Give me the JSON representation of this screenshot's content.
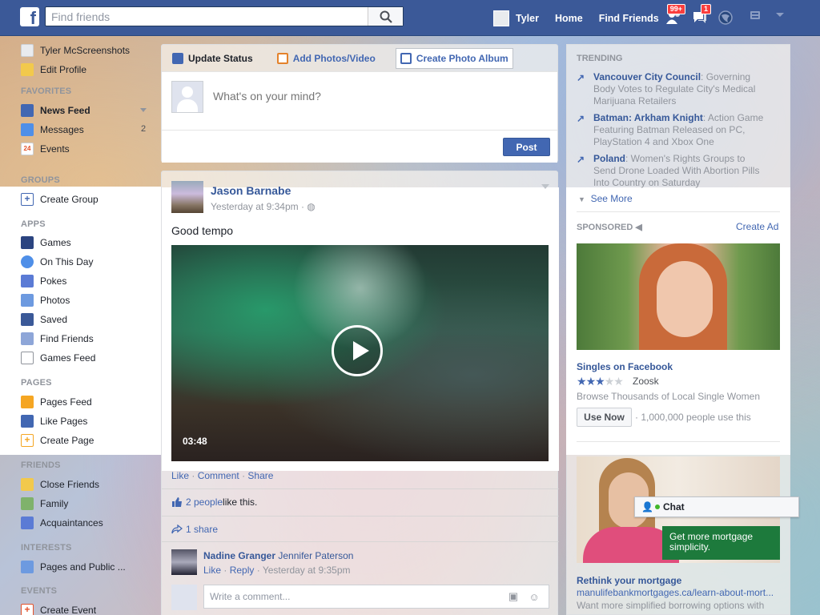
{
  "topbar": {
    "logo": "f",
    "search_placeholder": "Find friends",
    "user_name": "Tyler",
    "home": "Home",
    "find_friends": "Find Friends",
    "friend_requests_badge": "99+",
    "messages_badge": "1"
  },
  "left": {
    "profile_name": "Tyler McScreenshots",
    "edit_profile": "Edit Profile",
    "favorites_head": "FAVORITES",
    "news_feed": "News Feed",
    "messages": "Messages",
    "messages_count": "2",
    "events": "Events",
    "events_icon_num": "24",
    "groups_head": "GROUPS",
    "create_group": "Create Group",
    "apps_head": "APPS",
    "games": "Games",
    "on_this_day": "On This Day",
    "pokes": "Pokes",
    "photos": "Photos",
    "saved": "Saved",
    "find_friends": "Find Friends",
    "games_feed": "Games Feed",
    "pages_head": "PAGES",
    "pages_feed": "Pages Feed",
    "like_pages": "Like Pages",
    "create_page": "Create Page",
    "friends_head": "FRIENDS",
    "close_friends": "Close Friends",
    "family": "Family",
    "acquaintances": "Acquaintances",
    "interests_head": "INTERESTS",
    "pages_and_public": "Pages and Public ...",
    "events_head": "EVENTS",
    "create_event": "Create Event"
  },
  "composer": {
    "tab_update_status": "Update Status",
    "tab_add_photos": "Add Photos/Video",
    "tab_create_album": "Create Photo Album",
    "placeholder": "What's on your mind?",
    "post_label": "Post"
  },
  "story": {
    "author": "Jason Barnabe",
    "time": "Yesterday at 9:34pm · ",
    "text": "Good tempo",
    "video_duration": "03:48",
    "action_like": "Like",
    "action_comment": "Comment",
    "action_share": "Share",
    "likes_people": "2 people",
    "likes_suffix": " like this.",
    "shares": "1 share",
    "comment_name1": "Nadine Granger",
    "comment_name2": "Jennifer Paterson",
    "comment_like": "Like",
    "comment_reply": "Reply",
    "comment_time": "Yesterday at 9:35pm",
    "write_comment_placeholder": "Write a comment..."
  },
  "trending": {
    "head": "TRENDING",
    "items": [
      {
        "topic": "Vancouver City Council",
        "desc": ": Governing Body Votes to Regulate City's Medical Marijuana Retailers"
      },
      {
        "topic": "Batman: Arkham Knight",
        "desc": ": Action Game Featuring Batman Released on PC, PlayStation 4 and Xbox One"
      },
      {
        "topic": "Poland",
        "desc": ": Women's Rights Groups to Send Drone Loaded With Abortion Pills Into Country on Saturday"
      }
    ],
    "see_more": "See More"
  },
  "sponsored": {
    "head": "SPONSORED",
    "create_ad": "Create Ad",
    "ad1_title": "Singles on Facebook",
    "ad1_rating": 2.5,
    "ad1_brand": "Zoosk",
    "ad1_desc": "Browse Thousands of Local Single Women",
    "ad1_cta": "Use Now",
    "ad1_count": "· 1,000,000 people use this",
    "ad2_banner": "Get more mortgage simplicity.",
    "ad2_title": "Rethink your mortgage",
    "ad2_url": "manulifebankmortgages.ca/learn-about-mort...",
    "ad2_desc": "Want more simplified borrowing options with"
  },
  "chat": {
    "label": "Chat"
  },
  "colors": {
    "brand": "#3b5998",
    "link": "#4267b2",
    "badge": "#fa3e3e"
  }
}
